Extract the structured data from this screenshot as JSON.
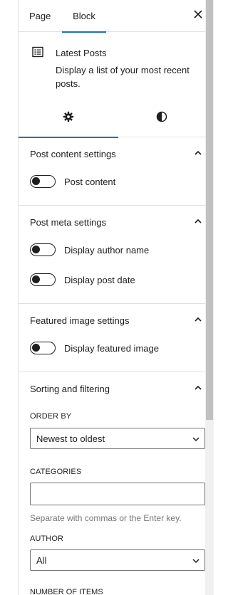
{
  "tabs": {
    "page": "Page",
    "block": "Block"
  },
  "block": {
    "icon": "list-icon",
    "title": "Latest Posts",
    "description": "Display a list of your most recent posts."
  },
  "sections": {
    "post_content": {
      "title": "Post content settings",
      "toggles": [
        {
          "label": "Post content",
          "on": false
        }
      ]
    },
    "post_meta": {
      "title": "Post meta settings",
      "toggles": [
        {
          "label": "Display author name",
          "on": false
        },
        {
          "label": "Display post date",
          "on": false
        }
      ]
    },
    "featured_image": {
      "title": "Featured image settings",
      "toggles": [
        {
          "label": "Display featured image",
          "on": false
        }
      ]
    },
    "sorting": {
      "title": "Sorting and filtering",
      "order_by": {
        "label": "ORDER BY",
        "value": "Newest to oldest"
      },
      "categories": {
        "label": "CATEGORIES",
        "value": "",
        "help": "Separate with commas or the Enter key."
      },
      "author": {
        "label": "AUTHOR",
        "value": "All"
      },
      "number_of_items_label": "NUMBER OF ITEMS"
    }
  }
}
